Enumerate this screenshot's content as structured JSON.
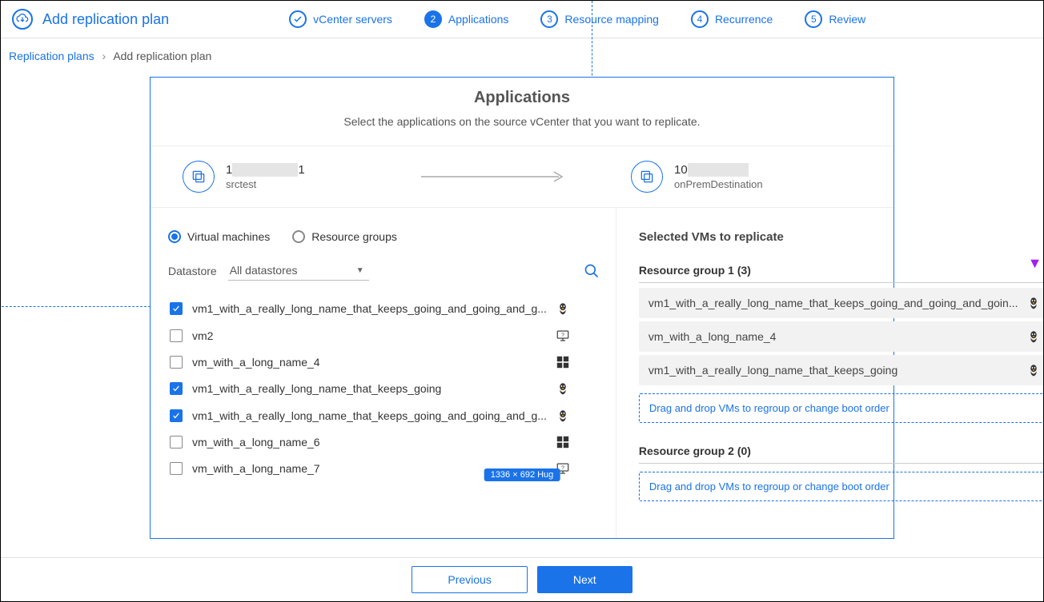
{
  "header": {
    "title": "Add replication plan",
    "steps": [
      {
        "label": "vCenter servers",
        "state": "done"
      },
      {
        "label": "Applications",
        "state": "active",
        "num": "2"
      },
      {
        "label": "Resource mapping",
        "state": "pending",
        "num": "3"
      },
      {
        "label": "Recurrence",
        "state": "pending",
        "num": "4"
      },
      {
        "label": "Review",
        "state": "pending",
        "num": "5"
      }
    ]
  },
  "breadcrumb": {
    "root": "Replication plans",
    "current": "Add replication plan"
  },
  "panel": {
    "title": "Applications",
    "subtitle": "Select the applications on the source vCenter that you want to replicate."
  },
  "source": {
    "ip_prefix": "1",
    "ip_suffix": "1",
    "name": "srctest"
  },
  "dest": {
    "ip_prefix": "10",
    "ip_suffix": "",
    "name": "onPremDestination"
  },
  "filters": {
    "radio_vm": "Virtual machines",
    "radio_rg": "Resource groups",
    "datastore_label": "Datastore",
    "datastore_value": "All datastores"
  },
  "vms": [
    {
      "name": "vm1_with_a_really_long_name_that_keeps_going_and_going_and_g...",
      "checked": true,
      "os": "linux"
    },
    {
      "name": "vm2",
      "checked": false,
      "os": "unknown"
    },
    {
      "name": "vm_with_a_long_name_4",
      "checked": false,
      "os": "windows"
    },
    {
      "name": "vm1_with_a_really_long_name_that_keeps_going",
      "checked": true,
      "os": "linux"
    },
    {
      "name": "vm1_with_a_really_long_name_that_keeps_going_and_going_and_g...",
      "checked": true,
      "os": "linux"
    },
    {
      "name": "vm_with_a_long_name_6",
      "checked": false,
      "os": "windows"
    },
    {
      "name": "vm_with_a_long_name_7",
      "checked": false,
      "os": "unknown"
    }
  ],
  "selected": {
    "title": "Selected VMs to replicate",
    "groups": [
      {
        "title": "Resource group 1 (3)",
        "items": [
          {
            "name": "vm1_with_a_really_long_name_that_keeps_going_and_going_and_goin...",
            "os": "linux"
          },
          {
            "name": "vm_with_a_long_name_4",
            "os": "linux"
          },
          {
            "name": "vm1_with_a_really_long_name_that_keeps_going",
            "os": "linux"
          }
        ],
        "dropzone": "Drag and drop VMs to regroup or change boot order"
      },
      {
        "title": "Resource group 2 (0)",
        "items": [],
        "dropzone": "Drag and drop VMs to regroup or change boot order"
      }
    ]
  },
  "size_badge": "1336 × 692 Hug",
  "footer": {
    "previous": "Previous",
    "next": "Next"
  }
}
